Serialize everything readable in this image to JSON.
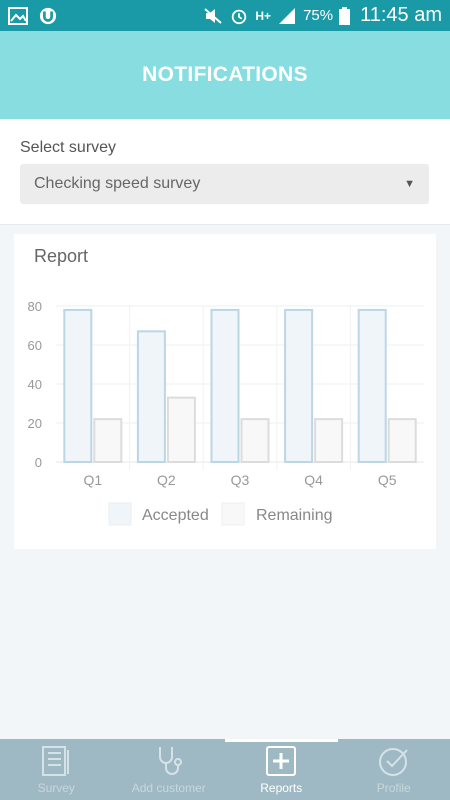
{
  "status_bar": {
    "battery_percent": "75%",
    "time": "11:45 am",
    "network": "H+"
  },
  "header": {
    "title": "NOTIFICATIONS"
  },
  "survey": {
    "label": "Select survey",
    "selected": "Checking speed survey"
  },
  "report": {
    "title": "Report"
  },
  "colors": {
    "status_bar": "#1a9aa6",
    "header": "#88dde0",
    "nav": "#9fb9c4",
    "accepted_fill": "#f0f5f9",
    "accepted_stroke": "#bcd6e4",
    "remaining_fill": "#f8f8f8",
    "remaining_stroke": "#dcdcdc"
  },
  "chart_data": {
    "type": "bar",
    "categories": [
      "Q1",
      "Q2",
      "Q3",
      "Q4",
      "Q5"
    ],
    "series": [
      {
        "name": "Accepted",
        "values": [
          78,
          67,
          78,
          78,
          78
        ]
      },
      {
        "name": "Remaining",
        "values": [
          22,
          33,
          22,
          22,
          22
        ]
      }
    ],
    "yticks": [
      "0",
      "20",
      "40",
      "60",
      "80"
    ],
    "ylim": [
      0,
      80
    ],
    "legend_position": "bottom"
  },
  "nav": {
    "items": [
      {
        "label": "Survey",
        "icon": "survey-icon",
        "active": false
      },
      {
        "label": "Add customer",
        "icon": "stethoscope-icon",
        "active": false
      },
      {
        "label": "Reports",
        "icon": "plus-box-icon",
        "active": true
      },
      {
        "label": "Profile",
        "icon": "check-circle-icon",
        "active": false
      }
    ]
  }
}
